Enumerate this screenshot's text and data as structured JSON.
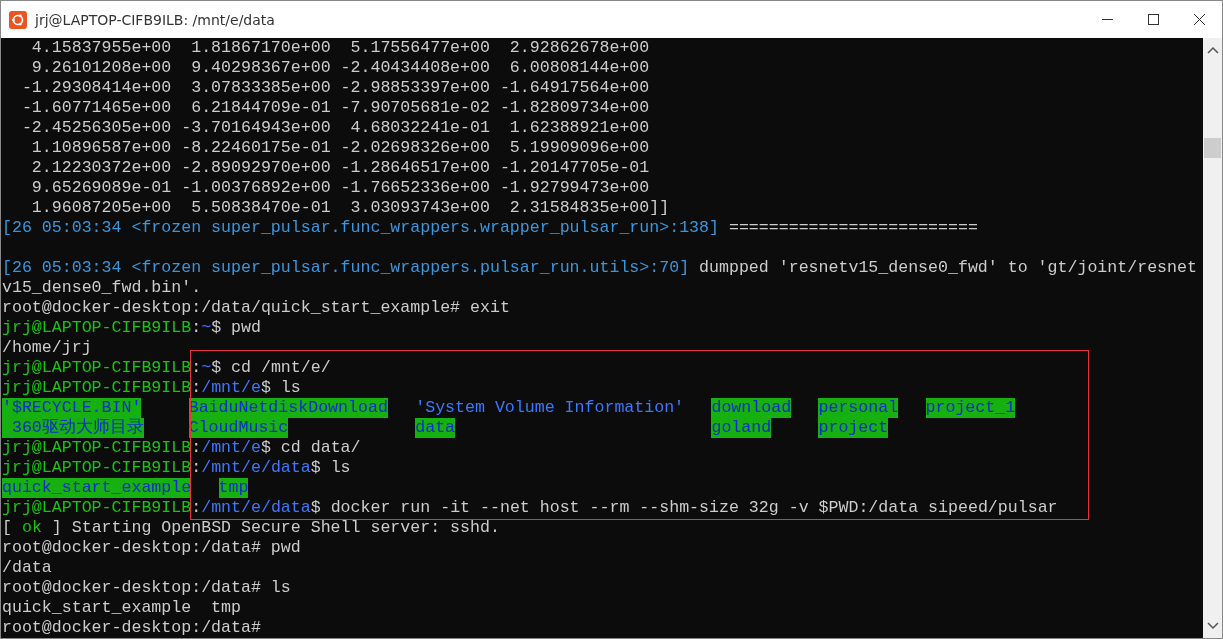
{
  "window": {
    "title": "jrj@LAPTOP-CIFB9ILB: /mnt/e/data"
  },
  "lines": [
    {
      "segments": [
        {
          "kind": "text",
          "text": "   4.15837955e+00  1.81867170e+00  5.17556477e+00  2.92862678e+00"
        }
      ]
    },
    {
      "segments": [
        {
          "kind": "text",
          "text": "   9.26101208e+00  9.40298367e+00 -2.40434408e+00  6.00808144e+00"
        }
      ]
    },
    {
      "segments": [
        {
          "kind": "text",
          "text": "  -1.29308414e+00  3.07833385e+00 -2.98853397e+00 -1.64917564e+00"
        }
      ]
    },
    {
      "segments": [
        {
          "kind": "text",
          "text": "  -1.60771465e+00  6.21844709e-01 -7.90705681e-02 -1.82809734e+00"
        }
      ]
    },
    {
      "segments": [
        {
          "kind": "text",
          "text": "  -2.45256305e+00 -3.70164943e+00  4.68032241e-01  1.62388921e+00"
        }
      ]
    },
    {
      "segments": [
        {
          "kind": "text",
          "text": "   1.10896587e+00 -8.22460175e-01 -2.02698326e+00  5.19909096e+00"
        }
      ]
    },
    {
      "segments": [
        {
          "kind": "text",
          "text": "   2.12230372e+00 -2.89092970e+00 -1.28646517e+00 -1.20147705e-01"
        }
      ]
    },
    {
      "segments": [
        {
          "kind": "text",
          "text": "   9.65269089e-01 -1.00376892e+00 -1.76652336e+00 -1.92799473e+00"
        }
      ]
    },
    {
      "segments": [
        {
          "kind": "text",
          "text": "   1.96087205e+00  5.50838470e-01  3.03093743e+00  2.31584835e+00]]"
        }
      ]
    },
    {
      "segments": [
        {
          "kind": "log",
          "text": "[26 05:03:34 <frozen super_pulsar.func_wrappers.wrapper_pulsar_run>:138]"
        },
        {
          "kind": "text",
          "text": " ========================="
        }
      ]
    },
    {
      "blank_line_before": true,
      "segments": [
        {
          "kind": "log",
          "text": "[26 05:03:34 <frozen super_pulsar.func_wrappers.pulsar_run.utils>:70]"
        },
        {
          "kind": "text",
          "text": " dumpped 'resnetv15_dense0_fwd' to 'gt/joint/resnet"
        }
      ]
    },
    {
      "segments": [
        {
          "kind": "text",
          "text": "v15_dense0_fwd.bin'."
        }
      ]
    },
    {
      "segments": [
        {
          "kind": "text",
          "text": "root@docker-desktop:/data/quick_start_example# exit"
        }
      ]
    },
    {
      "segments": [
        {
          "kind": "user",
          "text": "jrj@LAPTOP-CIFB9ILB"
        },
        {
          "kind": "text",
          "text": ":"
        },
        {
          "kind": "path",
          "text": "~"
        },
        {
          "kind": "text",
          "text": "$ pwd"
        }
      ]
    },
    {
      "segments": [
        {
          "kind": "text",
          "text": "/home/jrj"
        }
      ]
    },
    {
      "segments": [
        {
          "kind": "user",
          "text": "jrj@LAPTOP-CIFB9ILB"
        },
        {
          "kind": "text",
          "text": ":"
        },
        {
          "kind": "path",
          "text": "~"
        },
        {
          "kind": "text",
          "text": "$ cd /mnt/e/"
        }
      ]
    },
    {
      "segments": [
        {
          "kind": "user",
          "text": "jrj@LAPTOP-CIFB9ILB"
        },
        {
          "kind": "text",
          "text": ":"
        },
        {
          "kind": "path",
          "text": "/mnt/e"
        },
        {
          "kind": "text",
          "text": "$ ls"
        }
      ]
    },
    {
      "listing": [
        [
          {
            "text": "'$RECYCLE.BIN'",
            "highlighted": true
          },
          {
            "text": "BaiduNetdiskDownload",
            "highlighted": true
          },
          {
            "text": "'System Volume Information'",
            "highlighted": false
          },
          {
            "text": "download",
            "highlighted": true
          },
          {
            "text": "personal",
            "highlighted": true
          },
          {
            "text": "project_1",
            "highlighted": true
          }
        ],
        [
          {
            "text": " 360驱动大师目录",
            "highlighted": true
          },
          {
            "text": "CloudMusic",
            "highlighted": true
          },
          {
            "text": "data",
            "highlighted": true
          },
          {
            "text": "goland",
            "highlighted": true
          },
          {
            "text": "project",
            "highlighted": true
          }
        ]
      ]
    },
    {
      "segments": [
        {
          "kind": "user",
          "text": "jrj@LAPTOP-CIFB9ILB"
        },
        {
          "kind": "text",
          "text": ":"
        },
        {
          "kind": "path",
          "text": "/mnt/e"
        },
        {
          "kind": "text",
          "text": "$ cd data/"
        }
      ]
    },
    {
      "segments": [
        {
          "kind": "user",
          "text": "jrj@LAPTOP-CIFB9ILB"
        },
        {
          "kind": "text",
          "text": ":"
        },
        {
          "kind": "path",
          "text": "/mnt/e/data"
        },
        {
          "kind": "text",
          "text": "$ ls"
        }
      ]
    },
    {
      "listing": [
        [
          {
            "text": "quick_start_example",
            "highlighted": true
          },
          {
            "text": "tmp",
            "highlighted": true
          }
        ]
      ]
    },
    {
      "segments": [
        {
          "kind": "user",
          "text": "jrj@LAPTOP-CIFB9ILB"
        },
        {
          "kind": "text",
          "text": ":"
        },
        {
          "kind": "path",
          "text": "/mnt/e/data"
        },
        {
          "kind": "text",
          "text": "$ docker run -it --net host --rm --shm-size 32g -v $PWD:/data sipeed/pulsar"
        }
      ]
    },
    {
      "segments": [
        {
          "kind": "text",
          "text": "[ "
        },
        {
          "kind": "ok",
          "text": "ok"
        },
        {
          "kind": "text",
          "text": " ] Starting OpenBSD Secure Shell server: sshd."
        }
      ]
    },
    {
      "segments": [
        {
          "kind": "text",
          "text": "root@docker-desktop:/data# pwd"
        }
      ]
    },
    {
      "segments": [
        {
          "kind": "text",
          "text": "/data"
        }
      ]
    },
    {
      "segments": [
        {
          "kind": "text",
          "text": "root@docker-desktop:/data# ls"
        }
      ]
    },
    {
      "segments": [
        {
          "kind": "text",
          "text": "quick_start_example  tmp"
        }
      ]
    },
    {
      "segments": [
        {
          "kind": "text",
          "text": "root@docker-desktop:/data#"
        }
      ]
    }
  ]
}
